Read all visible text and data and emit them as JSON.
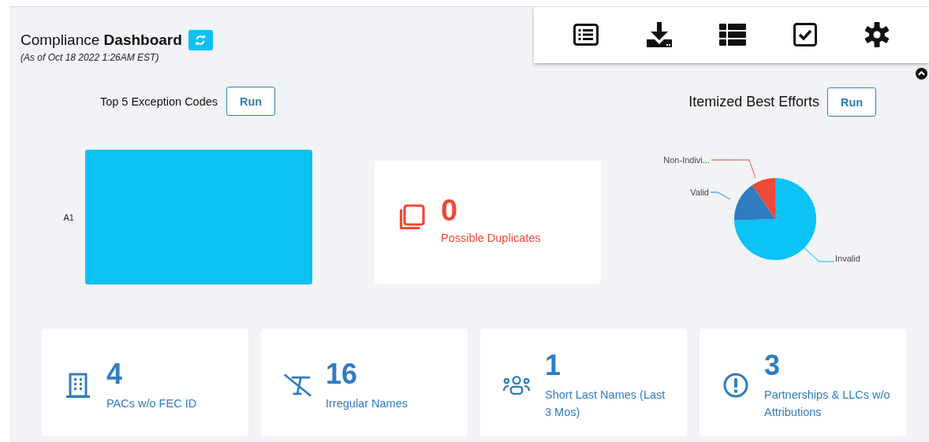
{
  "header": {
    "title": "Compliance **Dashboard**",
    "subtitle": "(As of Oct 18 2022 1:26AM EST)"
  },
  "exception_codes": {
    "title": "Top 5 Exception Codes",
    "run_button": "Run",
    "category_labels": [
      "A1"
    ]
  },
  "duplicates": {
    "count": "0",
    "label": "Possible Duplicates"
  },
  "best_efforts": {
    "title": "Itemized Best Efforts",
    "run_button": "Run",
    "slices": [
      {
        "label": "Non-Indivi...",
        "color": "#ef4a36"
      },
      {
        "label": "Valid",
        "color": "#2f7cc1"
      },
      {
        "label": "Invalid",
        "color": "#0bc3f4"
      }
    ]
  },
  "metrics": [
    {
      "kind": "building",
      "count": "4",
      "label": "PACs w/o FEC ID"
    },
    {
      "kind": "text-off",
      "count": "16",
      "label": "Irregular Names"
    },
    {
      "kind": "people",
      "count": "1",
      "label": "Short Last Names (Last 3 Mos)"
    },
    {
      "kind": "alert",
      "count": "3",
      "label": "Partnerships & LLCs w/o Attributions"
    }
  ]
}
